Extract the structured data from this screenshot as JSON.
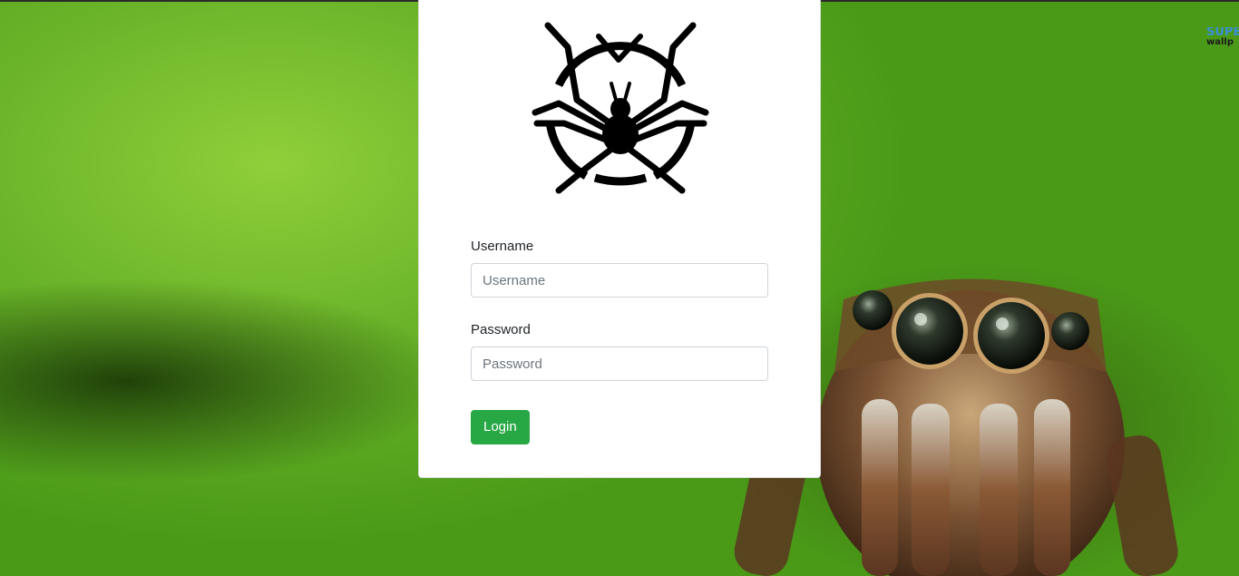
{
  "background": {
    "watermark_line1": "SUPE",
    "watermark_line2": "wallp"
  },
  "logo": {
    "icon": "spider-icon"
  },
  "form": {
    "username_label": "Username",
    "username_placeholder": "Username",
    "username_value": "",
    "password_label": "Password",
    "password_placeholder": "Password",
    "password_value": "",
    "login_label": "Login"
  },
  "colors": {
    "accent": "#28a745",
    "background_green": "#6cb52a",
    "card": "#ffffff"
  }
}
